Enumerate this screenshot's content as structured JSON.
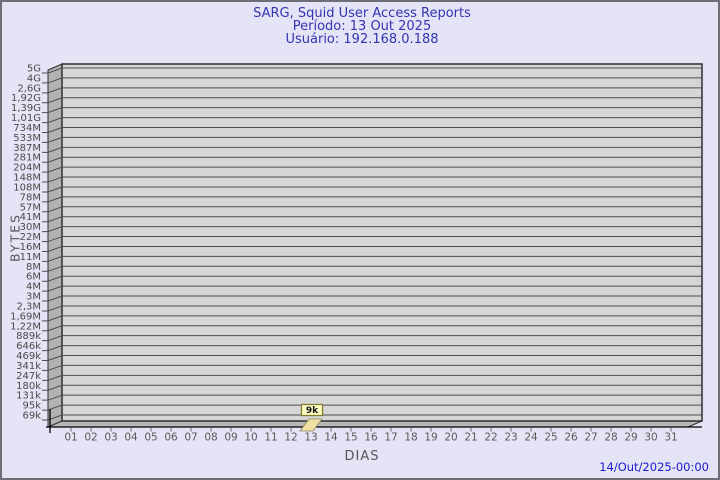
{
  "title": {
    "line1": "SARG, Squid User Access Reports",
    "line2": "Período: 13 Out 2025",
    "line3": "Usuário: 192.168.0.188"
  },
  "footer": {
    "timestamp": "14/Out/2025-00:00"
  },
  "chart_data": {
    "type": "bar",
    "title": "SARG, Squid User Access Reports",
    "subtitle_period": "Período: 13 Out 2025",
    "subtitle_user": "Usuário: 192.168.0.188",
    "xlabel": "DIAS",
    "ylabel": "BYTES",
    "x_categories": [
      "01",
      "02",
      "03",
      "04",
      "05",
      "06",
      "07",
      "08",
      "09",
      "10",
      "11",
      "12",
      "13",
      "14",
      "15",
      "16",
      "17",
      "18",
      "19",
      "20",
      "21",
      "22",
      "23",
      "24",
      "25",
      "26",
      "27",
      "28",
      "29",
      "30",
      "31"
    ],
    "y_tick_labels": [
      "5G",
      "4G",
      "2,6G",
      "1,92G",
      "1,39G",
      "1,01G",
      "734M",
      "533M",
      "387M",
      "281M",
      "204M",
      "148M",
      "108M",
      "78M",
      "57M",
      "41M",
      "30M",
      "22M",
      "16M",
      "11M",
      "8M",
      "6M",
      "4M",
      "3M",
      "2,3M",
      "1,69M",
      "1,22M",
      "889k",
      "646k",
      "469k",
      "341k",
      "247k",
      "180k",
      "131k",
      "95k",
      "69k"
    ],
    "y_axis_range_labels": {
      "min": "69k",
      "max": "5G"
    },
    "values_bytes_by_day": [
      0,
      0,
      0,
      0,
      0,
      0,
      0,
      0,
      0,
      0,
      0,
      0,
      9000,
      0,
      0,
      0,
      0,
      0,
      0,
      0,
      0,
      0,
      0,
      0,
      0,
      0,
      0,
      0,
      0,
      0,
      0
    ],
    "bars": [
      {
        "day": "13",
        "label": "9k",
        "value_bytes": 9000
      }
    ],
    "legend": null,
    "grid": "horizontal",
    "style_3d": true,
    "colors": {
      "background": "#e4e4f6",
      "frame_border": "#6e6e78",
      "title_text": "#3434b2",
      "timestamp_text": "#1a1ace",
      "plot_face": "#d6d6d6",
      "plot_wall": "#b2b2b2",
      "plot_floor": "#b8b8b8",
      "gridline": "#4c4c4c",
      "axis_line": "#000000",
      "tick_text": "#4a4a4a",
      "bar_fill": "#f0e0a4",
      "bar_stroke": "#8a8860",
      "value_box_fill": "#ffffc6",
      "value_box_border": "#847c2c",
      "value_box_text": "#111111"
    }
  }
}
